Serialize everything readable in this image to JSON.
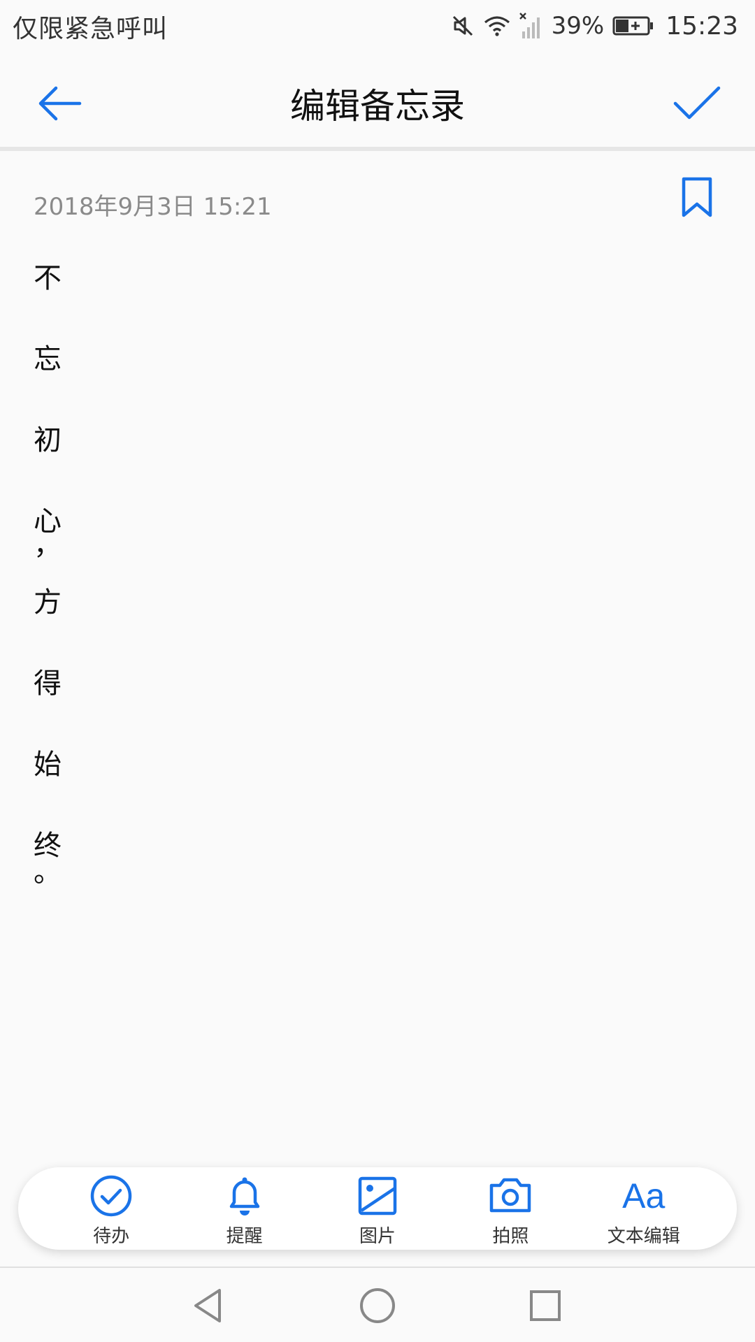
{
  "status_bar": {
    "carrier": "仅限紧急呼叫",
    "battery_percent": "39%",
    "time": "15:23",
    "icons": [
      "mute-icon",
      "wifi-icon",
      "signal-icon",
      "battery-icon"
    ]
  },
  "app_bar": {
    "title": "编辑备忘录",
    "back_icon": "back-arrow-icon",
    "done_icon": "check-icon"
  },
  "note": {
    "date": "2018年9月3日 15:21",
    "bookmark_icon": "bookmark-icon",
    "lines": [
      "不",
      "忘",
      "初",
      "心",
      "，",
      "方",
      "得",
      "始",
      "终",
      "。"
    ]
  },
  "toolbar": {
    "items": [
      {
        "label": "待办",
        "icon": "todo-check-icon"
      },
      {
        "label": "提醒",
        "icon": "bell-icon"
      },
      {
        "label": "图片",
        "icon": "image-icon"
      },
      {
        "label": "拍照",
        "icon": "camera-icon"
      },
      {
        "label": "文本编辑",
        "icon": "text-format-icon",
        "glyph": "Aa"
      }
    ]
  },
  "nav_bar": {
    "icons": [
      "nav-back-icon",
      "nav-home-icon",
      "nav-recents-icon"
    ]
  },
  "colors": {
    "accent": "#1a73e8",
    "background": "#fafafa"
  }
}
